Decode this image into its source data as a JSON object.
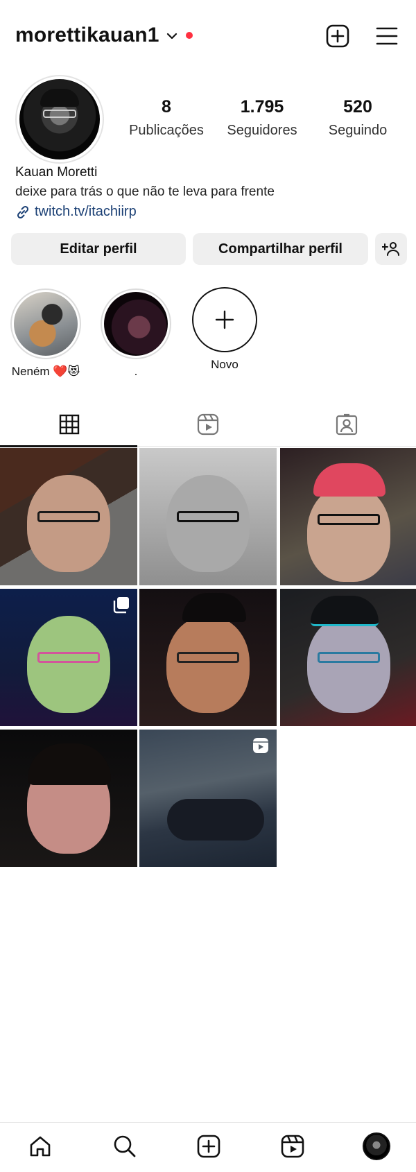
{
  "header": {
    "username": "morettikauan1",
    "has_notification": true,
    "accent_red": "#ff3040"
  },
  "profile": {
    "stats": [
      {
        "value": "8",
        "label": "Publicações"
      },
      {
        "value": "1.795",
        "label": "Seguidores"
      },
      {
        "value": "520",
        "label": "Seguindo"
      }
    ],
    "full_name": "Kauan Moretti",
    "bio": "deixe para trás o que não te leva para frente",
    "link": "twitch.tv/itachiirp",
    "link_color": "#1a3f74"
  },
  "actions": {
    "edit": "Editar perfil",
    "share": "Compartilhar perfil",
    "add_person_icon": "add-person-icon"
  },
  "highlights": [
    {
      "label": "Neném ❤️😻"
    },
    {
      "label": "."
    },
    {
      "label": "Novo"
    }
  ],
  "tabs": [
    "grid-icon",
    "reels-icon",
    "tagged-icon"
  ],
  "posts": [
    {
      "type": "photo"
    },
    {
      "type": "photo"
    },
    {
      "type": "photo"
    },
    {
      "type": "carousel"
    },
    {
      "type": "photo"
    },
    {
      "type": "photo"
    },
    {
      "type": "photo"
    },
    {
      "type": "reel"
    }
  ],
  "nav": [
    "home-icon",
    "search-icon",
    "create-icon",
    "reels-icon",
    "profile-avatar"
  ]
}
